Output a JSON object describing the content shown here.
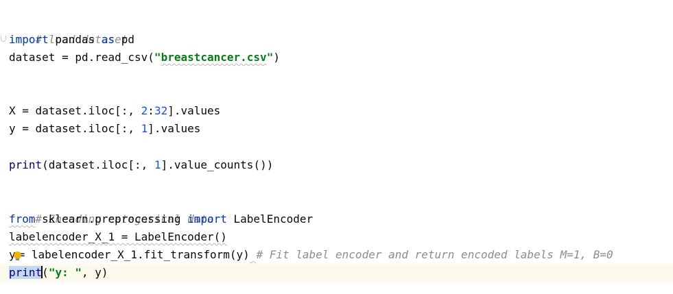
{
  "editor": {
    "lines": {
      "l1": {
        "comment": "# load dataset"
      },
      "l2": {
        "kw_import": "import",
        "module": " pandas ",
        "kw_as": "as",
        "alias": " pd"
      },
      "l3": {
        "prefix": "dataset = pd.read_csv(",
        "q1": "\"",
        "filename": "breastcancer.csv",
        "q2": "\"",
        "suffix": ")"
      },
      "l4": {
        "pre": "X = dataset.iloc[:, ",
        "n1": "2",
        "colon": ":",
        "n2": "32",
        "post": "].values"
      },
      "l5": {
        "pre": "y = dataset.iloc[:, ",
        "n1": "1",
        "post": "].values"
      },
      "l6": {
        "fn": "print",
        "pre": "(dataset.iloc[:, ",
        "n1": "1",
        "post": "].value_counts())"
      },
      "l7": {
        "comment": "# Encoding categorical data"
      },
      "l8": {
        "kw_from": "from",
        "module": " sklearn.preprocessing ",
        "kw_import": "import",
        "name": " LabelEncoder"
      },
      "l9": {
        "code": "labelencoder_X_1 = LabelEncoder()"
      },
      "l10": {
        "var": "y",
        "eq": "= labelencoder_X_1.fit_transform(y)",
        "space": " ",
        "comment": "# Fit label encoder and return encoded labels M=1, B=0"
      },
      "l11": {
        "fn": "print",
        "open": "(",
        "str": "\"y: \"",
        "post": ", y)"
      }
    }
  },
  "colors": {
    "keyword": "#0033b3",
    "string": "#067d17",
    "number": "#1750eb",
    "comment": "#8c8c8c",
    "builtin": "#000080",
    "current_line": "#fcfaed",
    "selection": "#c6d8ef"
  }
}
